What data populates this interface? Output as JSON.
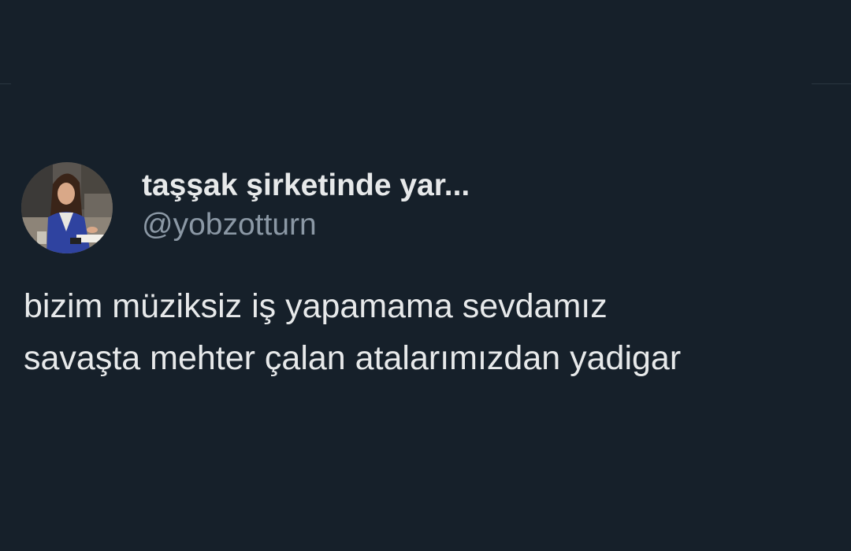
{
  "tweet": {
    "author": {
      "display_name": "taşşak şirketinde yar...",
      "handle": "@yobzotturn",
      "avatar_icon": "profile-photo"
    },
    "text_lines": [
      "bizim müziksiz iş yapamama sevdamız",
      "savaşta mehter çalan atalarımızdan yadigar"
    ]
  },
  "colors": {
    "background": "#16202a",
    "primary_text": "#e7e9ea",
    "secondary_text": "#8b98a5",
    "divider": "#2a3640"
  }
}
